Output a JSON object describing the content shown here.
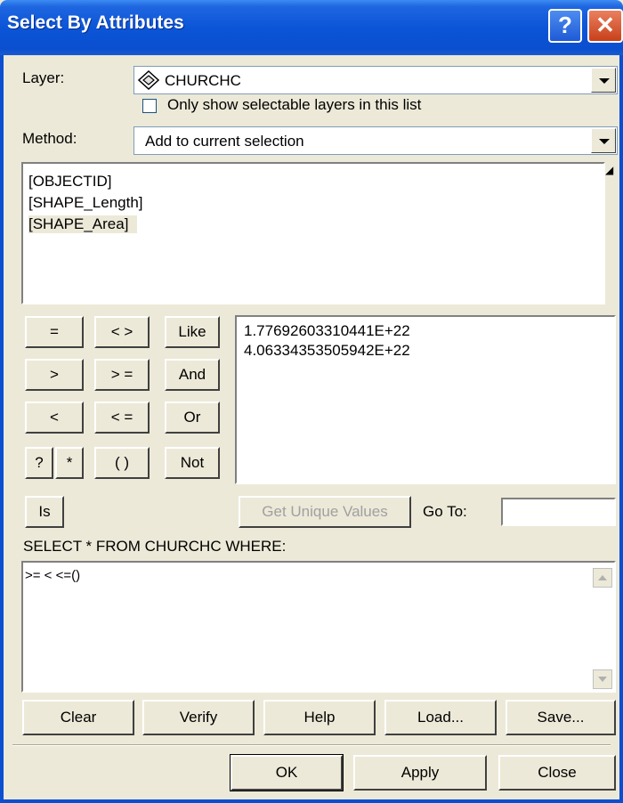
{
  "window": {
    "title": "Select By Attributes",
    "help_glyph": "?",
    "close_glyph": "✕"
  },
  "layer": {
    "label": "Layer:",
    "value": "CHURCHC",
    "icon": "layer-diamond-icon"
  },
  "selectable_only": {
    "label": "Only show selectable layers in this list",
    "checked": false
  },
  "method": {
    "label": "Method:",
    "value": "Add to current selection"
  },
  "fields": [
    "[OBJECTID]",
    "[SHAPE_Length]",
    "[SHAPE_Area]"
  ],
  "operators": {
    "eq": "=",
    "ne": "< >",
    "like": "Like",
    "gt": ">",
    "ge": "> =",
    "and": "And",
    "lt": "<",
    "le": "< =",
    "or": "Or",
    "q": "?",
    "star": "*",
    "paren": "( )",
    "not": "Not",
    "is": "Is"
  },
  "unique_values": [
    "1.77692603310441E+22",
    "4.06334353505942E+22"
  ],
  "get_unique_label": "Get Unique Values",
  "goto_label": "Go To:",
  "goto_value": "",
  "sql_prefix": "SELECT * FROM CHURCHC WHERE:",
  "sql_text": ">= < <=()",
  "actions": {
    "clear": "Clear",
    "verify": "Verify",
    "help": "Help",
    "load": "Load...",
    "save": "Save..."
  },
  "footer": {
    "ok": "OK",
    "apply": "Apply",
    "close": "Close"
  }
}
